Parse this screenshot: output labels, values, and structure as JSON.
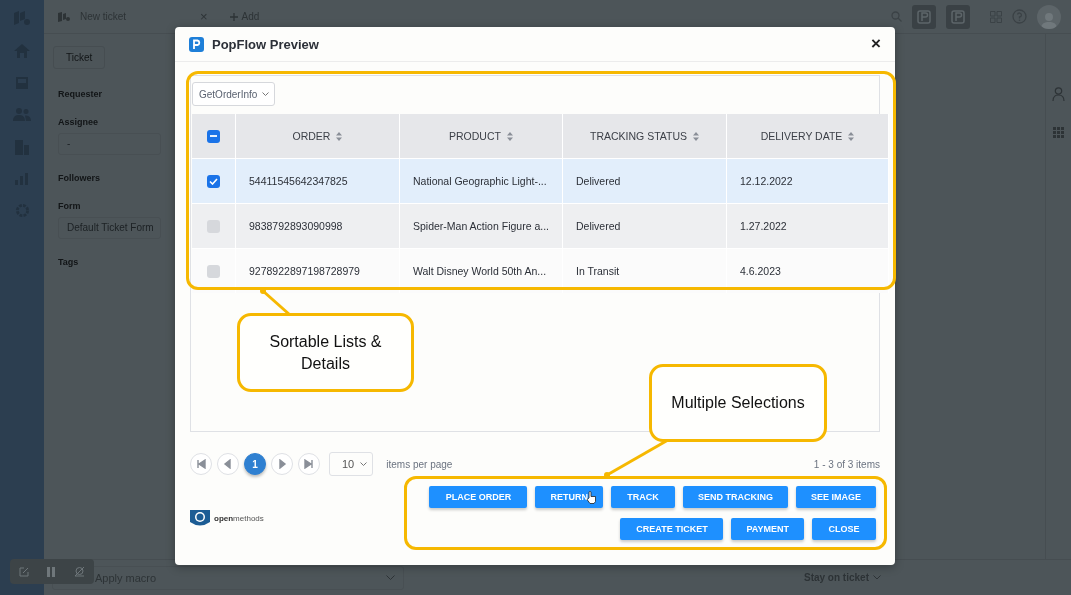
{
  "background": {
    "tab_title": "New ticket",
    "tab_close": "×",
    "add_label": "Add",
    "ticket_tab": "Ticket",
    "fields": [
      {
        "label": "Requester"
      },
      {
        "label": "Assignee",
        "value": "-"
      },
      {
        "label": "Followers"
      },
      {
        "label": "Form",
        "value": "Default Ticket Form"
      },
      {
        "label": "Tags"
      }
    ],
    "macro": {
      "value": "Apply macro"
    },
    "submit_option": "Stay on ticket"
  },
  "modal": {
    "title": "PopFlow Preview",
    "close": "×",
    "query_select": "GetOrderInfo",
    "table": {
      "select_all": {
        "indeterminate": true
      },
      "columns": [
        "ORDER",
        "PRODUCT",
        "TRACKING STATUS",
        "DELIVERY DATE"
      ],
      "rows": [
        {
          "selected": true,
          "cells": [
            "54411545642347825",
            "National Geographic Light-...",
            "Delivered",
            "12.12.2022"
          ]
        },
        {
          "selected": false,
          "cells": [
            "9838792893090998",
            "Spider-Man Action Figure a...",
            "Delivered",
            "1.27.2022"
          ]
        },
        {
          "selected": false,
          "cells": [
            "9278922897198728979",
            "Walt Disney World 50th An...",
            "In Transit",
            "4.6.2023"
          ]
        }
      ]
    },
    "pagination": {
      "pages": [
        {
          "label": "1",
          "selected": true
        }
      ],
      "page_size": "10",
      "page_size_label": "items per page",
      "summary": "1 - 3 of 3 items"
    },
    "brand": "**open**methods",
    "action_rows": [
      [
        "PLACE ORDER",
        "RETURN",
        "TRACK",
        "SEND TRACKING",
        "SEE IMAGE"
      ],
      [
        "CREATE TICKET",
        "PAYMENT",
        "CLOSE"
      ]
    ]
  },
  "callouts": [
    {
      "text": "Sortable Lists & Details"
    },
    {
      "text": "Multiple Selections"
    }
  ]
}
